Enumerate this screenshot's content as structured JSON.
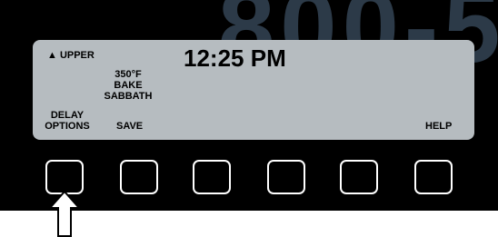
{
  "watermark": "800-5",
  "display": {
    "oven_label": "▲ UPPER",
    "time": "12:25 PM",
    "status_lines": [
      "350°F",
      "BAKE",
      "SABBATH"
    ],
    "softkey_labels": {
      "delay_options": [
        "DELAY",
        "OPTIONS"
      ],
      "save": "SAVE",
      "help": "HELP"
    }
  },
  "keypad": {
    "button_count": 6,
    "highlighted_button_index": 0
  },
  "colors": {
    "panel": "#000000",
    "lcd": "#b6bcc0",
    "watermark": "#2c3a48",
    "button_outline": "#ffffff"
  }
}
